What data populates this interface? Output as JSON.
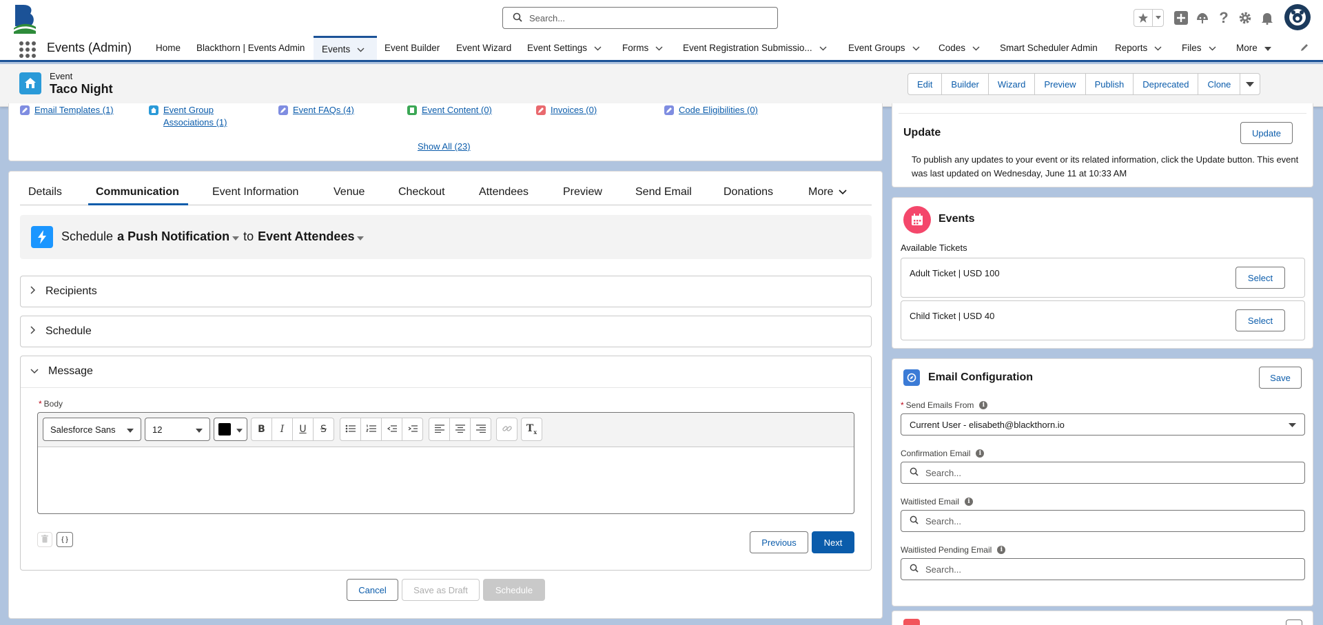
{
  "header": {
    "search_placeholder": "Search..."
  },
  "nav": {
    "app_name": "Events (Admin)",
    "items": [
      {
        "label": "Home"
      },
      {
        "label": "Blackthorn | Events Admin"
      },
      {
        "label": "Events"
      },
      {
        "label": "Event Builder"
      },
      {
        "label": "Event Wizard"
      },
      {
        "label": "Event Settings"
      },
      {
        "label": "Forms"
      },
      {
        "label": "Event Registration Submissio..."
      },
      {
        "label": "Event Groups"
      },
      {
        "label": "Codes"
      },
      {
        "label": "Smart Scheduler Admin"
      },
      {
        "label": "Reports"
      },
      {
        "label": "Files"
      },
      {
        "label": "More"
      }
    ]
  },
  "record": {
    "type": "Event",
    "name": "Taco Night",
    "actions": [
      "Edit",
      "Builder",
      "Wizard",
      "Preview",
      "Publish",
      "Deprecated",
      "Clone"
    ]
  },
  "related": {
    "links": [
      {
        "label": "Email Templates (1)",
        "icon": "email-template-icon"
      },
      {
        "label": "Event Group Associations (1)",
        "line1": "Event Group",
        "line2": "Associations (1)",
        "icon": "event-group-icon"
      },
      {
        "label": "Event FAQs (4)",
        "icon": "faq-icon"
      },
      {
        "label": "Event Content (0)",
        "icon": "content-icon"
      },
      {
        "label": "Invoices (0)",
        "icon": "invoice-icon"
      },
      {
        "label": "Code Eligibilities (0)",
        "icon": "code-icon"
      }
    ],
    "show_all": "Show All (23)"
  },
  "tabs": [
    "Details",
    "Communication",
    "Event Information",
    "Venue",
    "Checkout",
    "Attendees",
    "Preview",
    "Send Email",
    "Donations",
    "More"
  ],
  "schedule_bar": {
    "prefix": "Schedule",
    "channel": "a Push Notification",
    "connector": "to",
    "audience": "Event Attendees"
  },
  "sections": {
    "recipients": "Recipients",
    "schedule": "Schedule",
    "message": "Message"
  },
  "editor": {
    "body_label": "Body",
    "font": "Salesforce Sans",
    "size": "12",
    "color": "#000000",
    "merge_symbol": "{ }"
  },
  "buttons": {
    "previous": "Previous",
    "next": "Next",
    "cancel": "Cancel",
    "save_draft": "Save as Draft",
    "schedule": "Schedule"
  },
  "update_card": {
    "title": "Update",
    "button": "Update",
    "text": "To publish any updates to your event or its related information, click the Update button. This event was last updated on Wednesday, June 11 at 10:33 AM"
  },
  "events_card": {
    "title": "Events",
    "subtitle": "Available Tickets",
    "tickets": [
      {
        "label": "Adult Ticket | USD 100",
        "button": "Select"
      },
      {
        "label": "Child Ticket | USD 40",
        "button": "Select"
      }
    ]
  },
  "email_config": {
    "title": "Email Configuration",
    "save": "Save",
    "send_from_label": "Send Emails From",
    "send_from_value": "Current User - elisabeth@blackthorn.io",
    "confirmation_label": "Confirmation Email",
    "waitlisted_label": "Waitlisted Email",
    "waitlisted_pending_label": "Waitlisted Pending Email",
    "search_placeholder": "Search..."
  },
  "colors": {
    "brand": "#0b5cab",
    "nav_underline": "#1b5297",
    "events_icon": "#f4476b",
    "record_icon": "#2a9ad8",
    "email_icon": "#3b7bd6",
    "attendees_icon": "#f2545b"
  }
}
